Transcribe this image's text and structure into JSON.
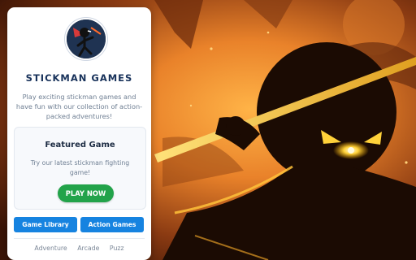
{
  "site": {
    "title": "STICKMAN GAMES",
    "description": "Play exciting stickman games and have fun with our collection of action-packed adventures!"
  },
  "featured": {
    "heading": "Featured Game",
    "description": "Try our latest stickman fighting game!",
    "play_label": "PLAY NOW"
  },
  "buttons": {
    "library_label": "Game Library",
    "action_label": "Action Games"
  },
  "tags": [
    "Adventure",
    "Arcade",
    "Puzz"
  ],
  "colors": {
    "title": "#17315a",
    "play_button": "#22a34a",
    "nav_button": "#1683e0",
    "hero_glow": "#f5a623"
  },
  "icons": {
    "avatar": "stickman-ninja-icon"
  }
}
